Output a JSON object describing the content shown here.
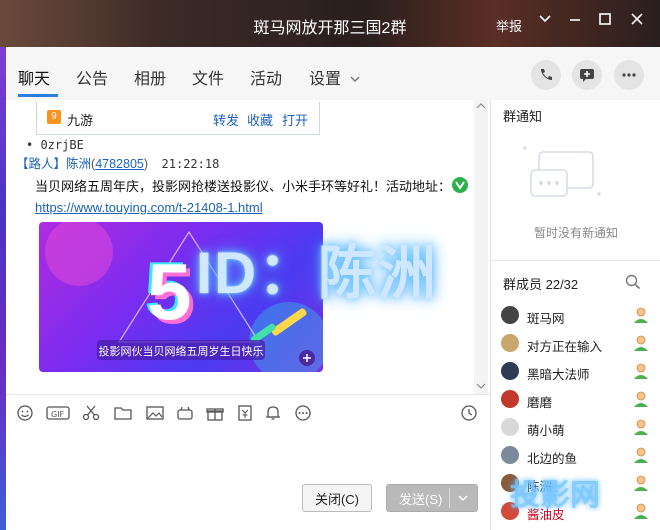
{
  "window": {
    "title": "斑马网放开那三国2群",
    "report_label": "举报"
  },
  "tabs": [
    "聊天",
    "公告",
    "相册",
    "文件",
    "活动",
    "设置"
  ],
  "share_card": {
    "app_name": "九游",
    "actions": [
      "转发",
      "收藏",
      "打开"
    ]
  },
  "messages": {
    "prev_line": "• 0zrjBE",
    "sender_tag": "【路人】",
    "sender_name": "陈洲",
    "sender_id": "4782805",
    "time": "21:22:18",
    "text": "当贝网络五周年庆，投影网抢楼送投影仪、小米手环等好礼！活动地址：",
    "url": "https://www.touying.com/t-21408-1.html",
    "banner_number": "5",
    "banner_caption": "投影网伙当贝网络五周岁生日快乐"
  },
  "overlay_text": "ID：陈洲",
  "input": {
    "close_label": "关闭(C)",
    "send_label": "发送(S)"
  },
  "notice": {
    "title": "群通知",
    "empty_text": "暂时没有新通知"
  },
  "members": {
    "title": "群成员 22/32",
    "list": [
      {
        "name": "斑马网",
        "color": "#444444",
        "name_color": "#222222"
      },
      {
        "name": "对方正在输入",
        "color": "#c9a66b",
        "name_color": "#222222"
      },
      {
        "name": "黑暗大法师",
        "color": "#2d3b55",
        "name_color": "#222222"
      },
      {
        "name": "磨磨",
        "color": "#c0392b",
        "name_color": "#222222"
      },
      {
        "name": "萌小萌",
        "color": "#d8d8d8",
        "name_color": "#222222"
      },
      {
        "name": "北边的鱼",
        "color": "#7a8a9a",
        "name_color": "#222222"
      },
      {
        "name": "陈洲",
        "color": "#8a5a3a",
        "name_color": "#222222"
      },
      {
        "name": "酱油皮",
        "color": "#d24a3a",
        "name_color": "#d0021b"
      }
    ]
  },
  "watermark": "投影网"
}
